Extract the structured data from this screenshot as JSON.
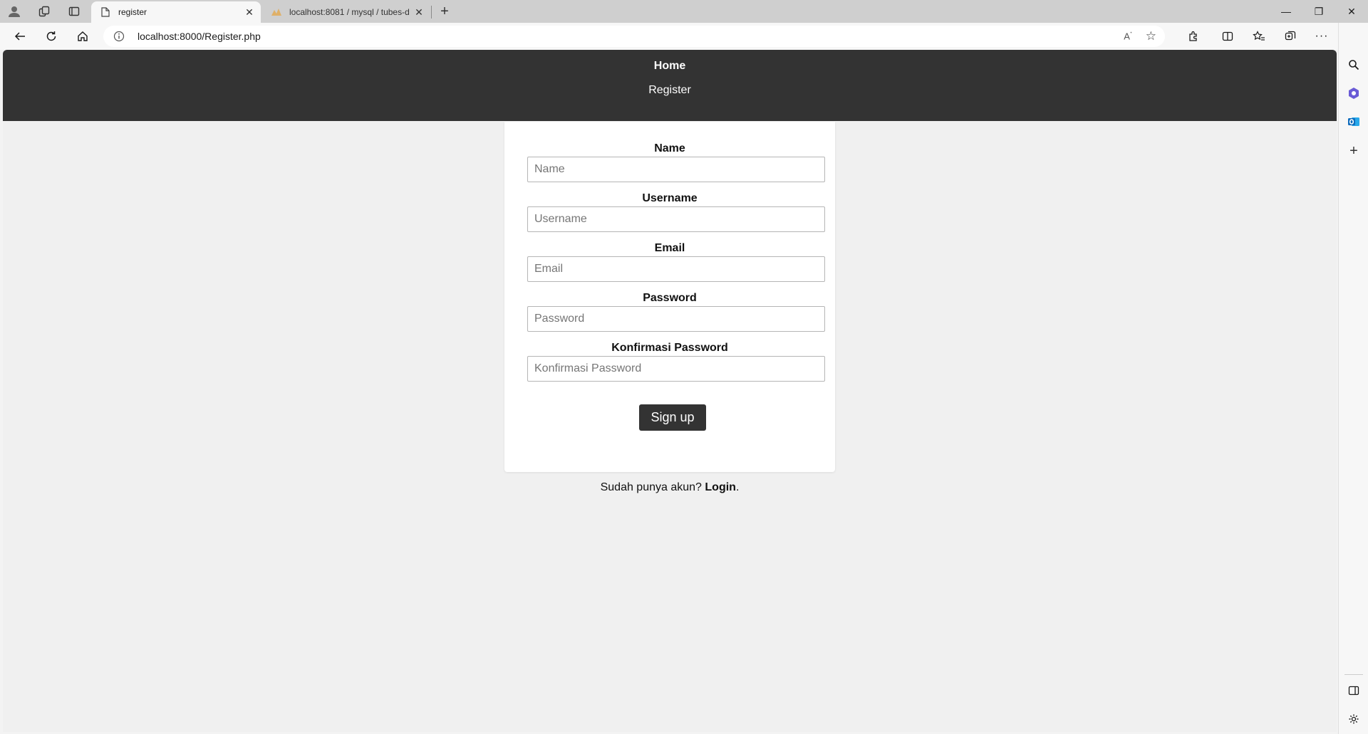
{
  "browser": {
    "tabs": [
      {
        "title": "register",
        "active": true
      },
      {
        "title": "localhost:8081 / mysql / tubes-d",
        "active": false
      }
    ],
    "address_bar": {
      "url": "localhost:8000/Register.php"
    },
    "window_controls": {
      "minimize": "—",
      "restore": "❐",
      "close": "✕"
    },
    "colors": {
      "tabstrip": "#cfcfcf",
      "toolbar": "#f7f7f7",
      "bing_accent": "#1a73e8"
    }
  },
  "page": {
    "nav": {
      "home": "Home",
      "register": "Register"
    },
    "form": {
      "fields": [
        {
          "label": "Name",
          "placeholder": "Name"
        },
        {
          "label": "Username",
          "placeholder": "Username"
        },
        {
          "label": "Email",
          "placeholder": "Email"
        },
        {
          "label": "Password",
          "placeholder": "Password"
        },
        {
          "label": "Konfirmasi Password",
          "placeholder": "Konfirmasi Password"
        }
      ],
      "submit_label": "Sign up"
    },
    "login_prompt": {
      "text": "Sudah punya akun? ",
      "link": "Login",
      "suffix": "."
    },
    "colors": {
      "header_bg": "#333333",
      "page_bg": "#f0f0f0",
      "card_bg": "#ffffff",
      "button_bg": "#333333"
    }
  },
  "icons": {
    "tabstrip": [
      "profile-icon",
      "workspaces-icon",
      "tab-actions-icon",
      "page-icon",
      "phpmyadmin-icon",
      "close-icon",
      "plus-icon"
    ],
    "toolbar": [
      "back-icon",
      "refresh-icon",
      "home-icon",
      "info-icon",
      "read-aloud-icon",
      "favorite-star-icon",
      "extensions-icon",
      "split-screen-icon",
      "favorites-icon",
      "collections-icon",
      "more-icon",
      "bing-icon"
    ],
    "sidebar": [
      "search-icon",
      "copilot-icon",
      "outlook-icon",
      "add-icon",
      "sidebar-toggle-icon",
      "settings-icon"
    ]
  }
}
